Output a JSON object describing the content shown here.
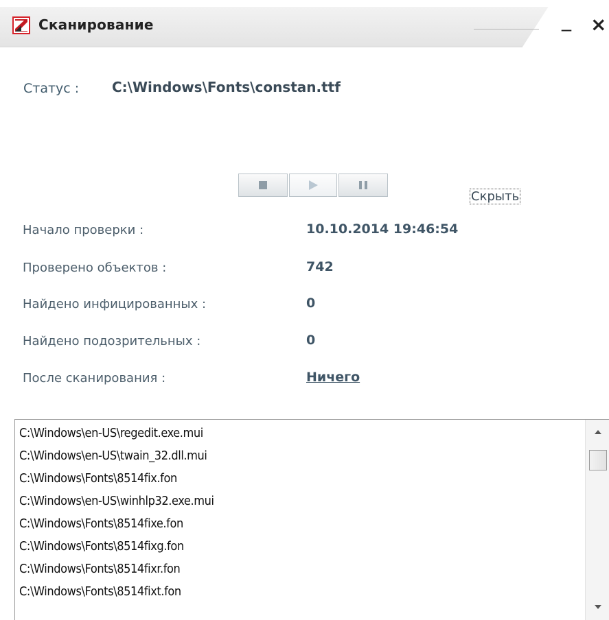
{
  "window": {
    "title": "Сканирование",
    "minimize_glyph": "_",
    "close_glyph": "×",
    "logo_icon": "scanner-logo-icon",
    "accent_color": "#d6222a"
  },
  "status": {
    "label": "Статус :",
    "value": "C:\\Windows\\Fonts\\constan.ttf"
  },
  "controls": {
    "stop_icon": "stop-icon",
    "play_icon": "play-icon",
    "pause_icon": "pause-icon",
    "hide_label": "Скрыть"
  },
  "info": [
    {
      "label": "Начало проверки :",
      "value": "10.10.2014 19:46:54"
    },
    {
      "label": "Проверено объектов :",
      "value": "742"
    },
    {
      "label": "Найдено инфицированных :",
      "value": "0"
    },
    {
      "label": "Найдено подозрительных :",
      "value": "0"
    },
    {
      "label": "После сканирования :",
      "value": "Ничего"
    }
  ],
  "log": [
    "C:\\Windows\\en-US\\regedit.exe.mui",
    "C:\\Windows\\en-US\\twain_32.dll.mui",
    "C:\\Windows\\Fonts\\8514fix.fon",
    "C:\\Windows\\en-US\\winhlp32.exe.mui",
    "C:\\Windows\\Fonts\\8514fixe.fon",
    "C:\\Windows\\Fonts\\8514fixg.fon",
    "C:\\Windows\\Fonts\\8514fixr.fon",
    "C:\\Windows\\Fonts\\8514fixt.fon"
  ]
}
